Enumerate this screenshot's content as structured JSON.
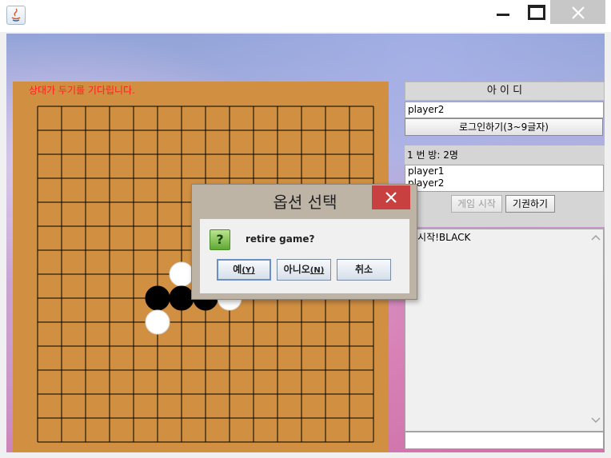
{
  "window": {
    "app_icon": "java-icon"
  },
  "board": {
    "status": "상대가 두기를 기다립니다.",
    "size": 15,
    "stones": [
      {
        "col": 6,
        "row": 7,
        "color": "white"
      },
      {
        "col": 5,
        "row": 8,
        "color": "black"
      },
      {
        "col": 6,
        "row": 8,
        "color": "black"
      },
      {
        "col": 7,
        "row": 8,
        "color": "black"
      },
      {
        "col": 8,
        "row": 8,
        "color": "white"
      },
      {
        "col": 5,
        "row": 9,
        "color": "white"
      }
    ]
  },
  "login": {
    "label": "아 이 디",
    "id_value": "player2",
    "login_button": "로그인하기(3~9글자)"
  },
  "room": {
    "label": "1 번 방: 2명",
    "users": [
      "player1",
      "player2"
    ],
    "start_button": "게임 시작",
    "forfeit_button": "기권하기"
  },
  "chat": {
    "log": "임시작!BLACK",
    "input": ""
  },
  "dialog": {
    "title": "옵션 선택",
    "message": "retire game?",
    "yes": "예",
    "yes_key": "(Y)",
    "no": "아니오",
    "no_key": "(N)",
    "cancel": "취소"
  }
}
